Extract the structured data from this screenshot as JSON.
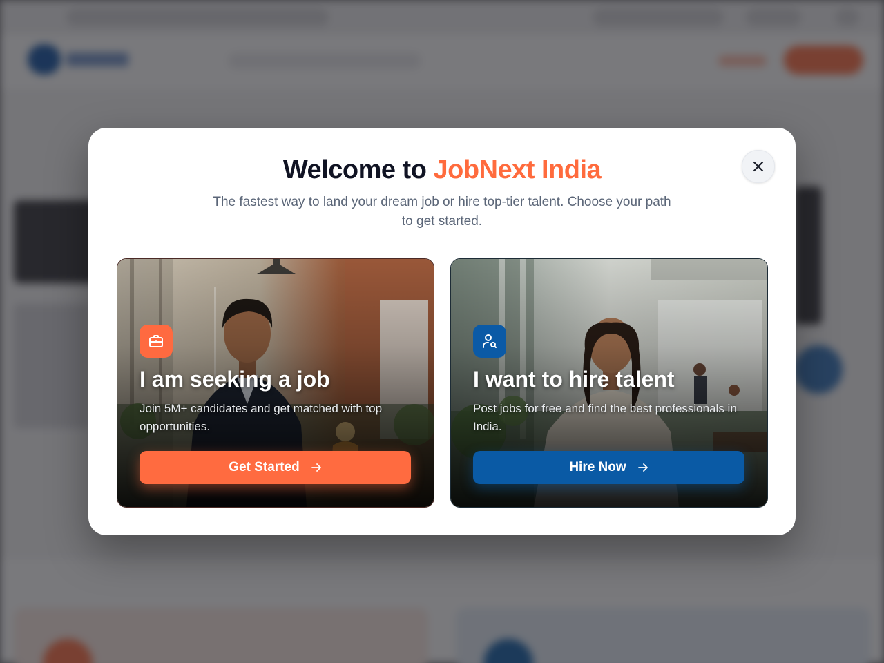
{
  "modal": {
    "title_prefix": "Welcome to",
    "title_brand": "JobNext India",
    "subtitle": "The fastest way to land your dream job or hire top-tier talent. Choose your path to get started."
  },
  "cards": {
    "seeker": {
      "icon": "briefcase-icon",
      "title": "I am seeking a job",
      "description": "Join 5M+ candidates and get matched with top opportunities.",
      "button_label": "Get Started",
      "accent": "#ff6b40"
    },
    "hirer": {
      "icon": "user-search-icon",
      "title": "I want to hire talent",
      "description": "Post jobs for free and find the best professionals in India.",
      "button_label": "Hire Now",
      "accent": "#0a5aa5"
    }
  },
  "colors": {
    "brand_orange": "#ff6b3d",
    "brand_blue": "#0b5aa6",
    "title_dark": "#101323"
  }
}
